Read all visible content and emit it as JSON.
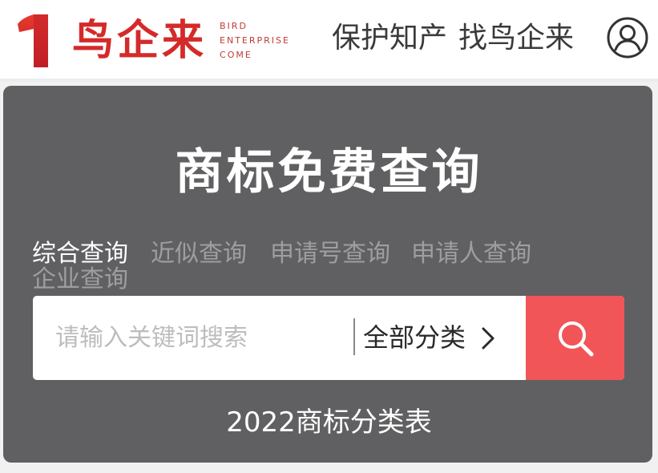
{
  "header": {
    "logo_text_cn": "鸟企来",
    "logo_text_en": [
      "BIRD",
      "ENTERPRISE",
      "COME"
    ],
    "nav_links": [
      "保护知产",
      "找鸟企来"
    ],
    "user_icon": "user-circle-icon"
  },
  "search_card": {
    "title": "商标免费查询",
    "tabs": [
      "综合查询",
      "近似查询",
      "申请号查询",
      "申请人查询",
      "企业查询"
    ],
    "active_tab": 0,
    "search_placeholder": "请输入关键词搜索",
    "category_label": "全部分类",
    "category_icon": "chevron-right-icon",
    "search_icon": "search-icon",
    "class_table_link": "2022商标分类表"
  },
  "colors": {
    "brand_red": "#d42a2a",
    "search_button": "#f25558",
    "card_background": "#606062",
    "tab_inactive": "#9e9ea0"
  }
}
